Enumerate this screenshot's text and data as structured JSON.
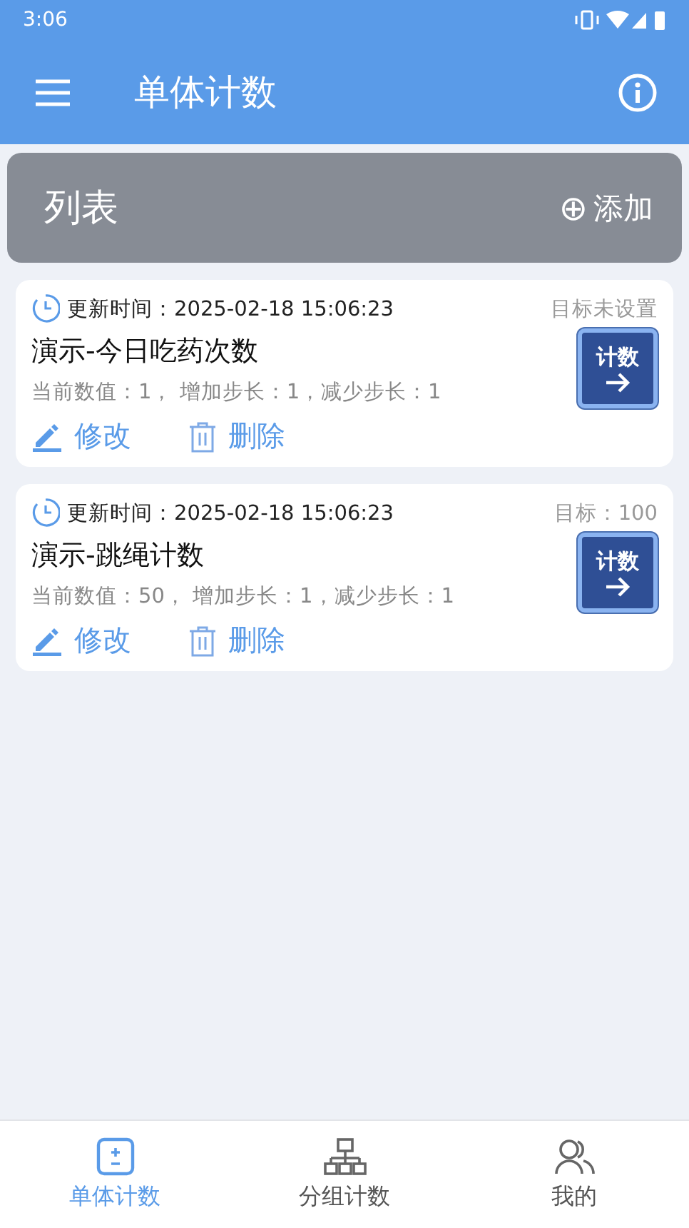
{
  "status_bar": {
    "time": "3:06"
  },
  "app_bar": {
    "title": "单体计数"
  },
  "list_header": {
    "title": "列表",
    "add_button": "添加",
    "add_icon": "⊕"
  },
  "items": [
    {
      "updated_label": "更新时间：2025-02-18 15:06:23",
      "target": "目标未设置",
      "name": "演示-今日吃药次数",
      "details": "当前数值：1， 增加步长：1，减少步长：1",
      "count_button": "计数",
      "edit": "修改",
      "delete": "删除"
    },
    {
      "updated_label": "更新时间：2025-02-18 15:06:23",
      "target": "目标：100",
      "name": "演示-跳绳计数",
      "details": "当前数值：50， 增加步长：1，减少步长：1",
      "count_button": "计数",
      "edit": "修改",
      "delete": "删除"
    }
  ],
  "bottom_nav": [
    {
      "kind": "single",
      "label": "单体计数",
      "selected": true
    },
    {
      "kind": "group",
      "label": "分组计数",
      "selected": false
    },
    {
      "kind": "profile",
      "label": "我的",
      "selected": false
    }
  ]
}
